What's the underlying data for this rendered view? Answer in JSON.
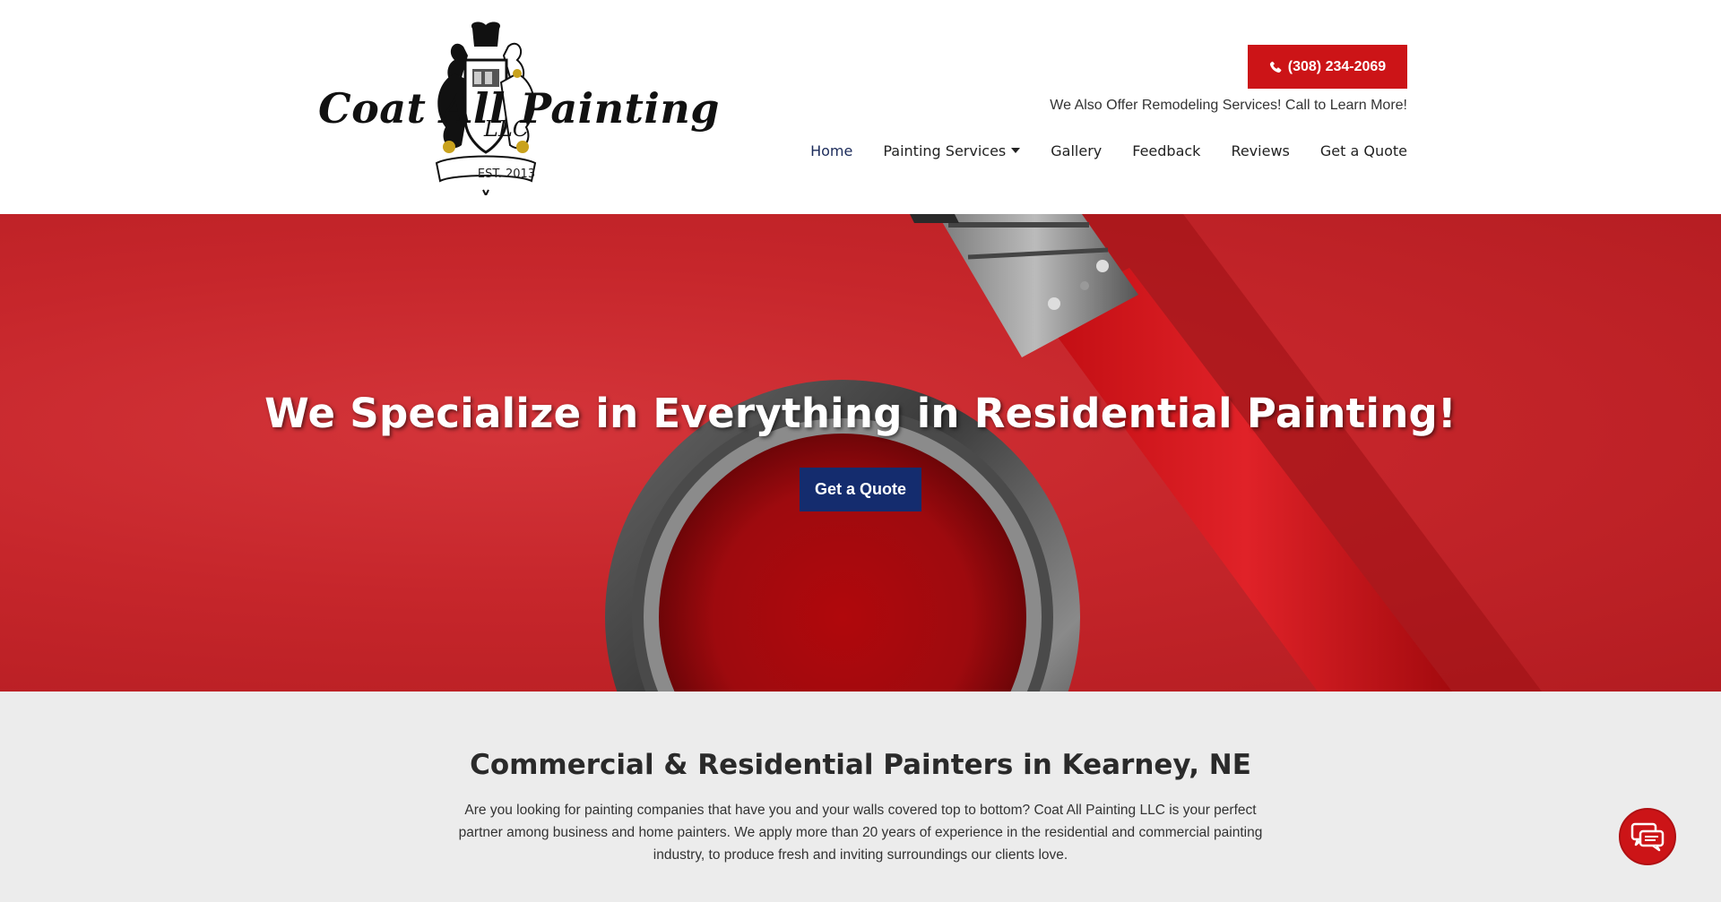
{
  "logo": {
    "name": "Coat All Painting",
    "suffix": "LLC",
    "established": "EST. 2013"
  },
  "header": {
    "phone_label": "(308) 234-2069",
    "tagline": "We Also Offer Remodeling Services! Call to Learn More!"
  },
  "nav": {
    "items": [
      {
        "label": "Home"
      },
      {
        "label": "Painting Services"
      },
      {
        "label": "Gallery"
      },
      {
        "label": "Feedback"
      },
      {
        "label": "Reviews"
      },
      {
        "label": "Get a Quote"
      }
    ]
  },
  "hero": {
    "title": "We Specialize in Everything in Residential Painting!",
    "cta_label": "Get a Quote"
  },
  "intro": {
    "title": "Commercial & Residential Painters in Kearney, NE",
    "body": "Are you looking for painting companies that have you and your walls covered top to bottom? Coat All Painting LLC is your perfect partner among business and home painters. We apply more than 20 years of experience in the residential and commercial painting industry, to produce fresh and inviting surroundings our clients love."
  },
  "colors": {
    "brand_red": "#cc1417",
    "navy": "#142c6e",
    "hero_red": "#c6262b",
    "section_gray": "#ececec"
  },
  "icons": {
    "phone": "phone-icon",
    "dropdown": "caret-down-icon",
    "chat": "chat-bubbles-icon"
  }
}
